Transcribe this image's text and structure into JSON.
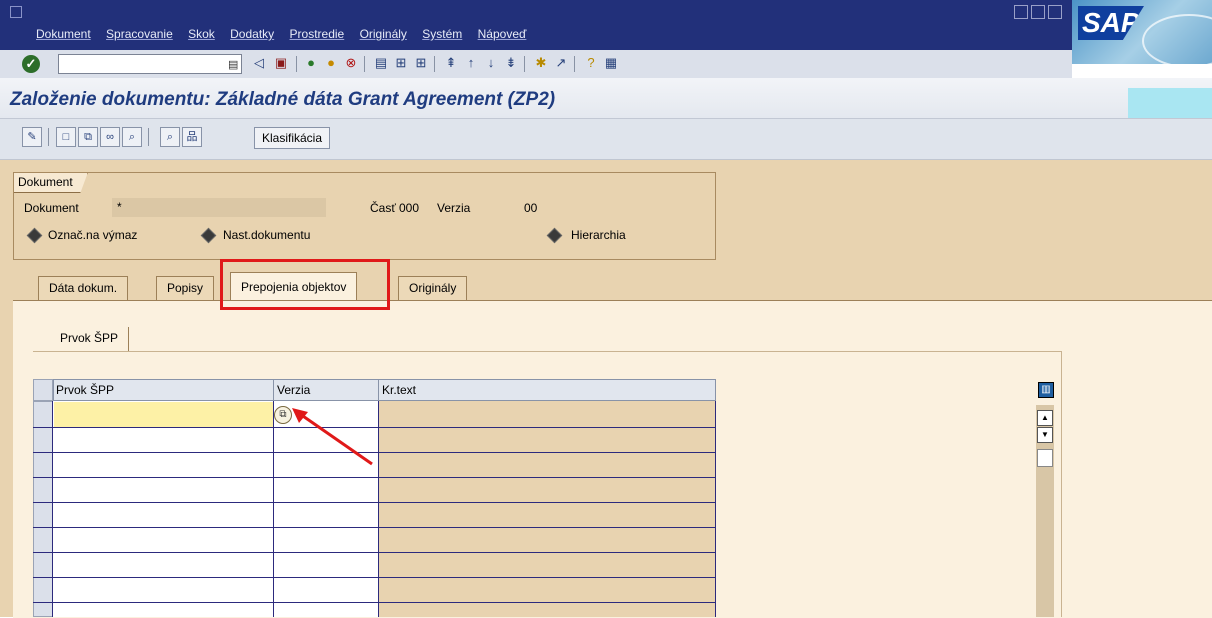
{
  "menubar": {
    "items": [
      "Dokument",
      "Spracovanie",
      "Skok",
      "Dodatky",
      "Prostredie",
      "Originály",
      "Systém",
      "Nápoveď"
    ],
    "logo": "SAP"
  },
  "systoolbar": {
    "command_value": "",
    "icons": [
      "ok-icon",
      "back-icon",
      "save-icon",
      "back-nav-icon",
      "exit-icon",
      "cancel-icon",
      "print-icon",
      "find-icon",
      "find-next-icon",
      "first-page-icon",
      "prev-page-icon",
      "next-page-icon",
      "last-page-icon",
      "new-session-icon",
      "shortcut-icon",
      "help-icon",
      "layout-icon"
    ]
  },
  "page": {
    "title": "Založenie dokumentu: Základné dáta Grant Agreement (ZP2)"
  },
  "apptoolbar": {
    "klasifikacia_label": "Klasifikácia"
  },
  "document_group": {
    "title": "Dokument",
    "dokument_label": "Dokument",
    "dokument_value": "*",
    "cast_label": "Časť",
    "cast_value": "000",
    "verzia_label": "Verzia",
    "verzia_value": "00",
    "radio_oznac": "Označ.na výmaz",
    "radio_nast": "Nast.dokumentu",
    "radio_hier": "Hierarchia"
  },
  "tabs": [
    {
      "label": "Dáta dokum."
    },
    {
      "label": "Popisy"
    },
    {
      "label": "Prepojenia objektov",
      "active": true
    },
    {
      "label": "Originály"
    }
  ],
  "subtab": {
    "label": "Prvok ŠPP"
  },
  "table": {
    "columns": [
      "Prvok ŠPP",
      "Verzia",
      "Kr.text"
    ],
    "rows": [
      [
        "",
        "",
        ""
      ],
      [
        "",
        "",
        ""
      ],
      [
        "",
        "",
        ""
      ],
      [
        "",
        "",
        ""
      ],
      [
        "",
        "",
        ""
      ],
      [
        "",
        "",
        ""
      ],
      [
        "",
        "",
        ""
      ],
      [
        "",
        "",
        ""
      ],
      [
        "",
        "",
        ""
      ]
    ]
  },
  "colors": {
    "menubar_bg": "#22307a",
    "title_color": "#1f3c80",
    "main_bg": "#e8d3b0",
    "highlight_red": "#e01919",
    "active_cell": "#fdf1a6"
  }
}
